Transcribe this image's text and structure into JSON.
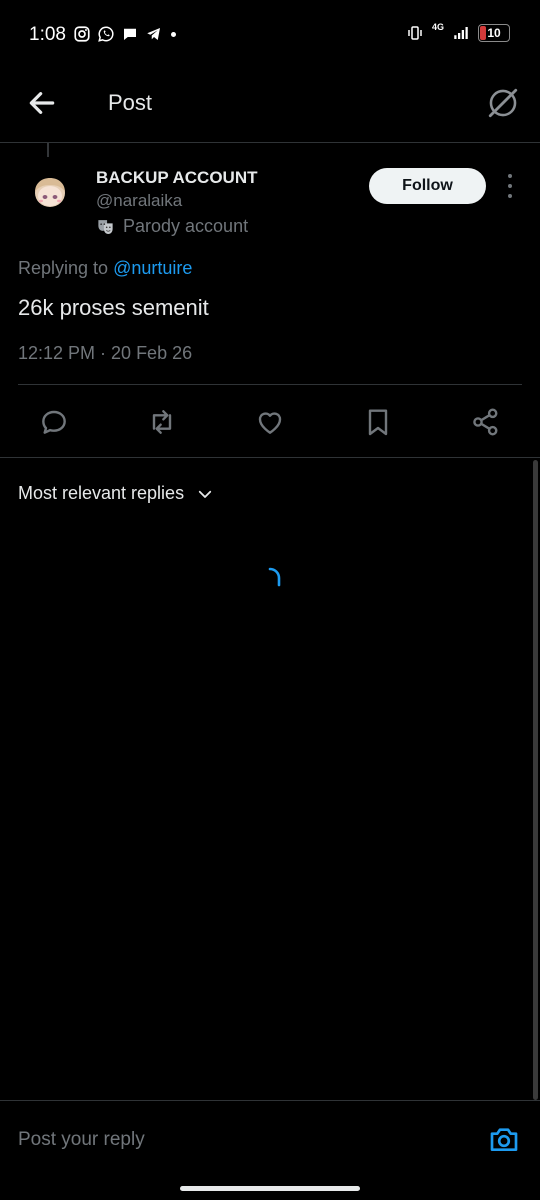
{
  "status_bar": {
    "time": "1:08",
    "network": "4G",
    "battery": "10",
    "icons": [
      "instagram-icon",
      "whatsapp-icon",
      "messages-icon",
      "telegram-icon"
    ]
  },
  "header": {
    "title": "Post"
  },
  "post": {
    "display_name": "BACKUP ACCOUNT",
    "handle": "@naralaika",
    "badge": "Parody account",
    "follow_label": "Follow",
    "replying_prefix": "Replying to ",
    "replying_to": "@nurtuire",
    "text": "26k proses semenit",
    "meta": "12:12 PM · 20 Feb 26"
  },
  "replies": {
    "sort_label": "Most relevant replies"
  },
  "composer": {
    "placeholder": "Post your reply"
  },
  "colors": {
    "accent": "#1d9bf0",
    "background": "#000000",
    "muted": "#71767b",
    "battery_low": "#d43a3a"
  }
}
